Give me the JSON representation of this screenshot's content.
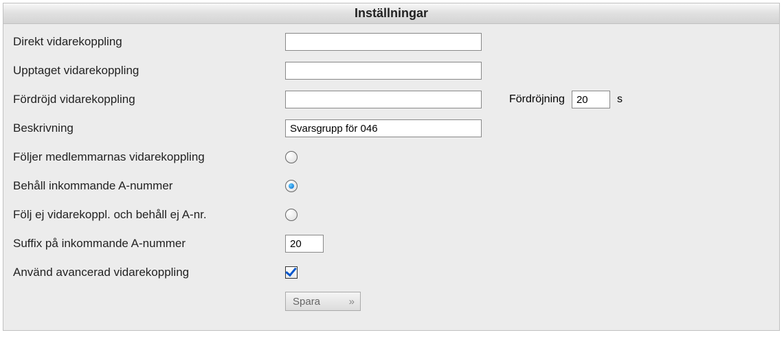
{
  "header": {
    "title": "Inställningar"
  },
  "fields": {
    "direct_forward": {
      "label": "Direkt vidarekoppling",
      "value": ""
    },
    "busy_forward": {
      "label": "Upptaget vidarekoppling",
      "value": ""
    },
    "delayed_forward": {
      "label": "Fördröjd vidarekoppling",
      "value": ""
    },
    "delay": {
      "label": "Fördröjning",
      "value": "20",
      "unit": "s"
    },
    "description": {
      "label": "Beskrivning",
      "value": "Svarsgrupp för 046"
    },
    "follow_members": {
      "label": "Följer medlemmarnas vidarekoppling"
    },
    "keep_anumber": {
      "label": "Behåll inkommande A-nummer"
    },
    "no_follow_no_keep": {
      "label": "Följ ej vidarekoppl. och behåll ej A-nr."
    },
    "suffix": {
      "label": "Suffix på inkommande A-nummer",
      "value": "20"
    },
    "use_advanced": {
      "label": "Använd avancerad vidarekoppling"
    }
  },
  "buttons": {
    "save": "Spara"
  }
}
